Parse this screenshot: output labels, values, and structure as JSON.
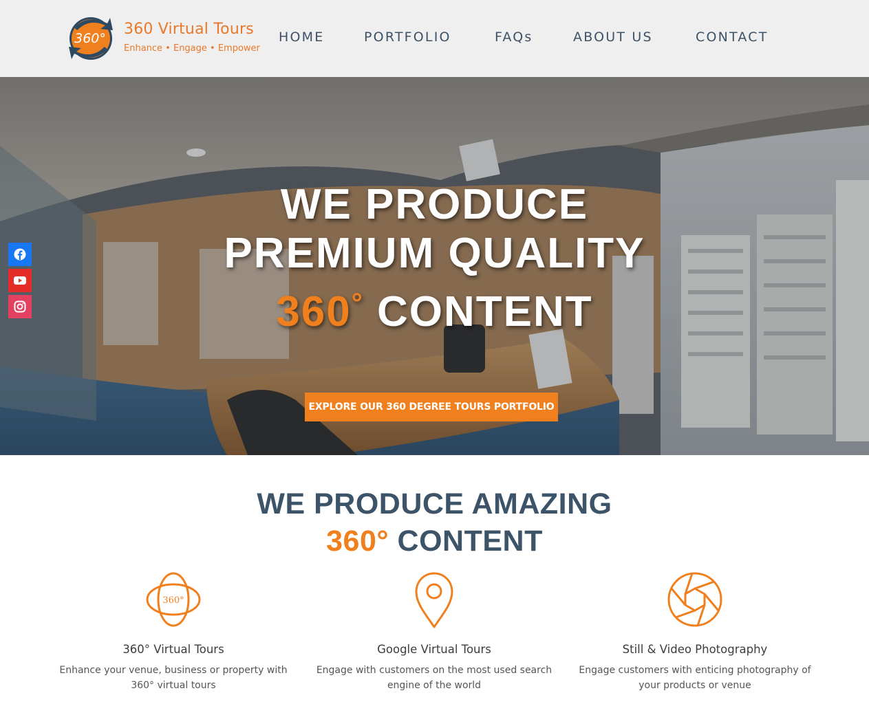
{
  "brand": {
    "title": "360 Virtual Tours",
    "tagline": "Enhance • Engage • Empower",
    "logo_text": "360°",
    "accent_color": "#f07f1e",
    "logo_dark_color": "#2e4a63"
  },
  "nav": {
    "items": [
      {
        "label": "HOME"
      },
      {
        "label": "PORTFOLIO"
      },
      {
        "label": "FAQs"
      },
      {
        "label": "ABOUT US"
      },
      {
        "label": "CONTACT"
      }
    ]
  },
  "hero": {
    "line1": "WE PRODUCE",
    "line2": "PREMIUM QUALITY",
    "line3_accent": "360",
    "line3_degree": "°",
    "line3_rest": " CONTENT",
    "cta_label": "EXPLORE OUR 360 DEGREE TOURS PORTFOLIO"
  },
  "social": [
    {
      "icon": "facebook-icon",
      "color": "#1877f2"
    },
    {
      "icon": "youtube-icon",
      "color": "#e52d27"
    },
    {
      "icon": "instagram-icon",
      "color": "#e4405f"
    }
  ],
  "section": {
    "title_line1": "WE PRODUCE AMAZING",
    "title_line2_accent": "360°",
    "title_line2_rest": " CONTENT"
  },
  "services": [
    {
      "icon": "globe-360-icon",
      "icon_text": "360°",
      "title": "360° Virtual Tours",
      "description": "Enhance your venue, business or property with 360° virtual tours"
    },
    {
      "icon": "map-pin-icon",
      "title": "Google Virtual Tours",
      "description": "Engage with customers on the most used search engine of the world"
    },
    {
      "icon": "camera-aperture-icon",
      "title": "Still & Video Photography",
      "description": "Engage customers with enticing photography of your products or venue"
    }
  ]
}
